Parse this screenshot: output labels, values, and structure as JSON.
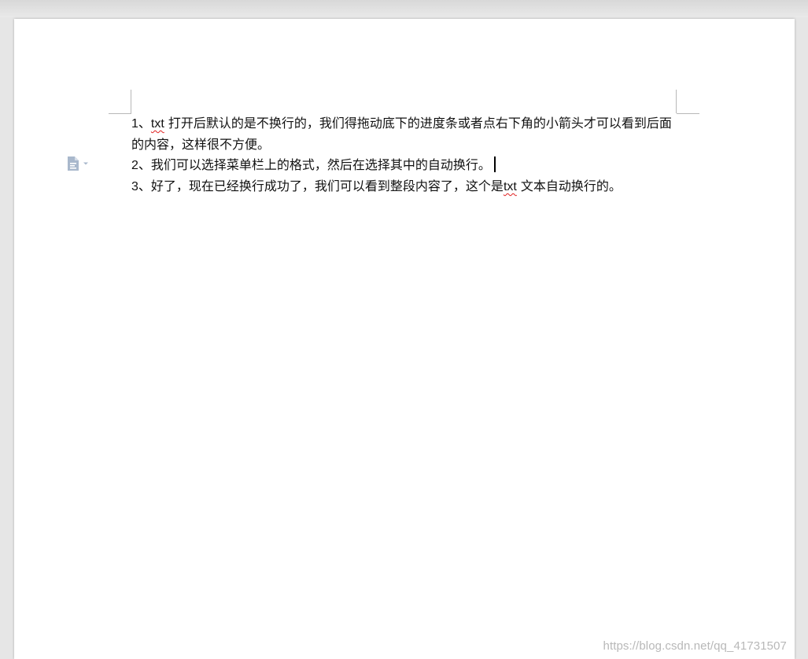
{
  "document": {
    "paragraphs": [
      {
        "number": "1",
        "sep": "、",
        "keyword": "txt",
        "rest": "打开后默认的是不换行的，我们得拖动底下的进度条或者点右下角的小箭头才可以看到后面的内容，这样很不方便。"
      },
      {
        "number": "2",
        "sep": "、",
        "text": "我们可以选择菜单栏上的格式，然后在选择其中的自动换行。"
      },
      {
        "number": "3",
        "sep": "、",
        "text_before": "好了，现在已经换行成功了，我们可以看到整段内容了，这个是",
        "keyword": "txt",
        "text_after": "文本自动换行的。"
      }
    ]
  },
  "paste_options": {
    "icon": "paste-options-icon",
    "dropdown_icon": "caret-down-icon",
    "color": "#a9b8cc"
  },
  "watermark": "https://blog.csdn.net/qq_41731507",
  "colors": {
    "spelling_underline": "#e02020",
    "page": "#ffffff",
    "background": "#e6e6e6"
  }
}
